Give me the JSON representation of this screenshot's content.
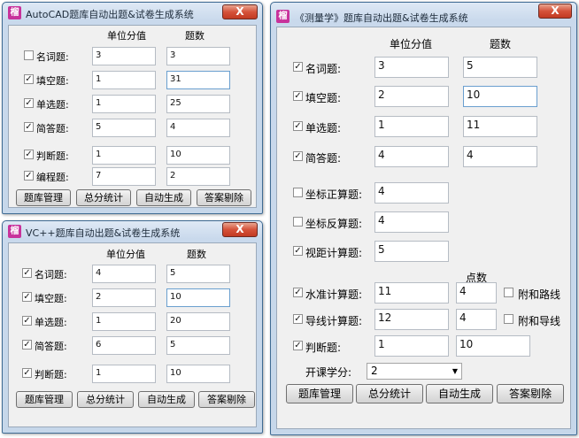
{
  "icon_glyph": "榴",
  "close_glyph": "X",
  "win1": {
    "title": "AutoCAD题库自动出题&试卷生成系统",
    "hdr_value": "单位分值",
    "hdr_count": "题数",
    "rows": [
      {
        "label": "名词题:",
        "checked": "",
        "value": "3",
        "count": "3"
      },
      {
        "label": "填空题:",
        "checked": "✓",
        "value": "1",
        "count": "31"
      },
      {
        "label": "单选题:",
        "checked": "✓",
        "value": "1",
        "count": "25"
      },
      {
        "label": "简答题:",
        "checked": "✓",
        "value": "5",
        "count": "4"
      },
      {
        "label": "判断题:",
        "checked": "✓",
        "value": "1",
        "count": "10"
      },
      {
        "label": "编程题:",
        "checked": "✓",
        "value": "7",
        "count": "2"
      }
    ],
    "buttons": [
      "题库管理",
      "总分统计",
      "自动生成",
      "答案剔除"
    ]
  },
  "win2": {
    "title": "VC++题库自动出题&试卷生成系统",
    "hdr_value": "单位分值",
    "hdr_count": "题数",
    "rows": [
      {
        "label": "名词题:",
        "checked": "✓",
        "value": "4",
        "count": "5"
      },
      {
        "label": "填空题:",
        "checked": "✓",
        "value": "2",
        "count": "10"
      },
      {
        "label": "单选题:",
        "checked": "✓",
        "value": "1",
        "count": "20"
      },
      {
        "label": "简答题:",
        "checked": "✓",
        "value": "6",
        "count": "5"
      },
      {
        "label": "判断题:",
        "checked": "✓",
        "value": "1",
        "count": "10"
      }
    ],
    "buttons": [
      "题库管理",
      "总分统计",
      "自动生成",
      "答案剔除"
    ]
  },
  "win3": {
    "title": "《测量学》题库自动出题&试卷生成系统",
    "hdr_value": "单位分值",
    "hdr_count": "题数",
    "hdr_points": "点数",
    "rows": [
      {
        "label": "名词题:",
        "checked": "✓",
        "value": "3",
        "count": "5"
      },
      {
        "label": "填空题:",
        "checked": "✓",
        "value": "2",
        "count": "10"
      },
      {
        "label": "单选题:",
        "checked": "✓",
        "value": "1",
        "count": "11"
      },
      {
        "label": "简答题:",
        "checked": "✓",
        "value": "4",
        "count": "4"
      },
      {
        "label": "坐标正算题:",
        "checked": "",
        "value": "4"
      },
      {
        "label": "坐标反算题:",
        "checked": "",
        "value": "4"
      },
      {
        "label": "视距计算题:",
        "checked": "✓",
        "value": "5"
      },
      {
        "label": "水准计算题:",
        "checked": "✓",
        "value": "11",
        "count": "4",
        "extra_label": "附和路线",
        "extra_checked": ""
      },
      {
        "label": "导线计算题:",
        "checked": "✓",
        "value": "12",
        "count": "4",
        "extra_label": "附和导线",
        "extra_checked": ""
      },
      {
        "label": "判断题:",
        "checked": "✓",
        "value": "1",
        "count": "10"
      }
    ],
    "semester_label": "开课学分:",
    "semester_value": "2",
    "dropdown_glyph": "▼",
    "buttons": [
      "题库管理",
      "总分统计",
      "自动生成",
      "答案剔除"
    ]
  }
}
